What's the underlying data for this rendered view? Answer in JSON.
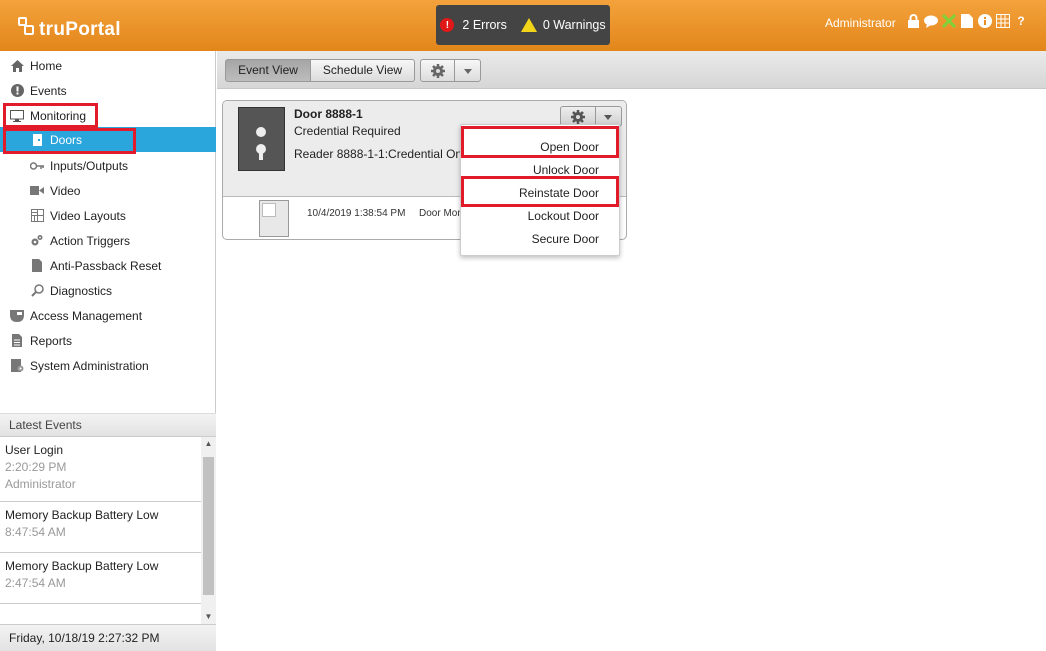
{
  "header": {
    "logo_text": "truPortal",
    "errors_label": "2 Errors",
    "warnings_label": "0 Warnings",
    "user": "Administrator",
    "icons": [
      "lock-icon",
      "chat-icon",
      "network-icon",
      "report-icon",
      "info-icon",
      "grid-icon",
      "help-icon"
    ]
  },
  "sidebar": {
    "items": [
      {
        "label": "Home",
        "icon": "home-icon"
      },
      {
        "label": "Events",
        "icon": "alert-icon"
      },
      {
        "label": "Monitoring",
        "icon": "monitor-icon"
      },
      {
        "label": "Doors",
        "icon": "door-icon"
      },
      {
        "label": "Inputs/Outputs",
        "icon": "key-icon"
      },
      {
        "label": "Video",
        "icon": "camera-icon"
      },
      {
        "label": "Video Layouts",
        "icon": "layout-icon"
      },
      {
        "label": "Action Triggers",
        "icon": "gears-icon"
      },
      {
        "label": "Anti-Passback Reset",
        "icon": "document-icon"
      },
      {
        "label": "Diagnostics",
        "icon": "magnifier-icon"
      },
      {
        "label": "Access Management",
        "icon": "badge-icon"
      },
      {
        "label": "Reports",
        "icon": "report-icon"
      },
      {
        "label": "System Administration",
        "icon": "admin-icon"
      }
    ],
    "latest_events_title": "Latest Events",
    "events": [
      {
        "title": "User Login",
        "time": "2:20:29 PM",
        "user": "Administrator"
      },
      {
        "title": "Memory Backup Battery Low",
        "time": "8:47:54 AM"
      },
      {
        "title": "Memory Backup Battery Low",
        "time": "2:47:54 AM"
      }
    ],
    "footer_datetime": "Friday, 10/18/19 2:27:32 PM"
  },
  "toolbar": {
    "event_view": "Event View",
    "schedule_view": "Schedule View"
  },
  "door_card": {
    "name": "Door 8888-1",
    "status": "Credential Required",
    "reader": "Reader 8888-1-1:Credential Only",
    "event_time": "10/4/2019 1:38:54 PM",
    "event_text": "Door Mon"
  },
  "menu": {
    "items": [
      "Open Door",
      "Unlock Door",
      "Reinstate Door",
      "Lockout Door",
      "Secure Door"
    ]
  },
  "colors": {
    "header_orange": "#e88f22",
    "active_blue": "#2aa6dd",
    "highlight_red": "#e21b2b"
  }
}
